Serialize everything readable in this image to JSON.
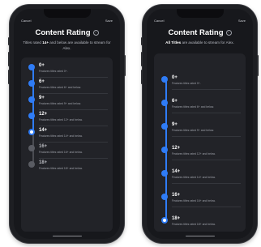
{
  "colors": {
    "accent": "#2f7cf6",
    "inactive": "#5a5c63",
    "background": "#17181c"
  },
  "left_phone": {
    "cancel": "Cancel",
    "save": "Save",
    "title": "Content Rating",
    "info_icon": "info-icon",
    "subtitle_prefix": "Titles rated ",
    "subtitle_bold": "14+",
    "subtitle_suffix": " and below are available to stream for Alex.",
    "selected_index": 4,
    "items": [
      {
        "age": "0+",
        "desc": "Features titles rated 0+."
      },
      {
        "age": "6+",
        "desc": "Features titles rated 6+ and below."
      },
      {
        "age": "9+",
        "desc": "Features titles rated 9+ and below."
      },
      {
        "age": "12+",
        "desc": "Features titles rated 12+ and below."
      },
      {
        "age": "14+",
        "desc": "Features titles rated 14+ and below."
      },
      {
        "age": "16+",
        "desc": "Features titles rated 16+ and below."
      },
      {
        "age": "18+",
        "desc": "Features titles rated 18+ and below."
      }
    ]
  },
  "right_phone": {
    "cancel": "Cancel",
    "save": "Save",
    "title": "Content Rating",
    "info_icon": "info-icon",
    "subtitle_bold": "All Titles",
    "subtitle_suffix": " are available to stream for Alex.",
    "selected_index": 6,
    "items": [
      {
        "age": "0+",
        "desc": "Features titles rated 0+."
      },
      {
        "age": "6+",
        "desc": "Features titles rated 6+ and below."
      },
      {
        "age": "9+",
        "desc": "Features titles rated 9+ and below."
      },
      {
        "age": "12+",
        "desc": "Features titles rated 12+ and below."
      },
      {
        "age": "14+",
        "desc": "Features titles rated 14+ and below."
      },
      {
        "age": "16+",
        "desc": "Features titles rated 16+ and below."
      },
      {
        "age": "18+",
        "desc": "Features titles rated 18+ and below."
      }
    ]
  }
}
